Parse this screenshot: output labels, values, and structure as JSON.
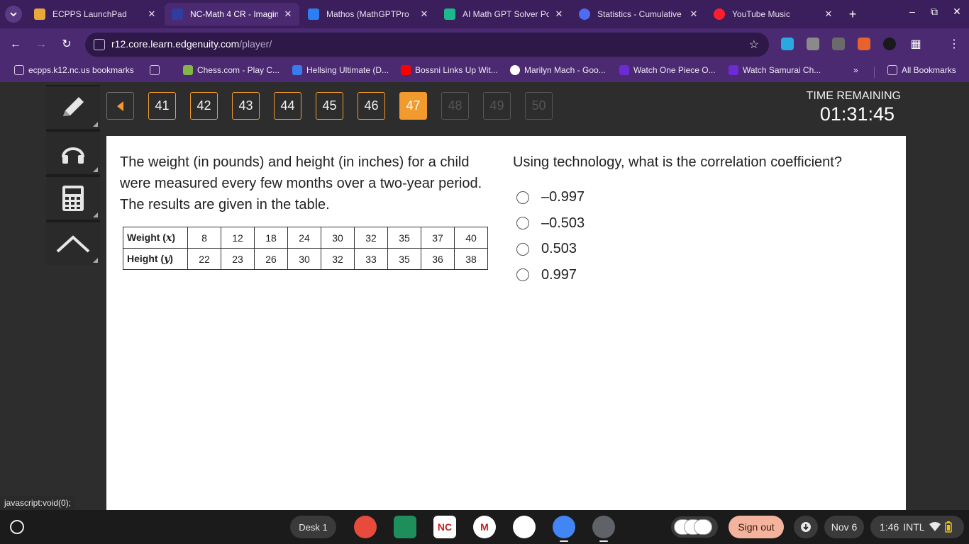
{
  "browser": {
    "tabs": [
      {
        "title": "ECPPS LaunchPad",
        "icon": "launchpad-icon",
        "color": "#e8a93a",
        "active": false
      },
      {
        "title": "NC-Math 4 CR - Imagin",
        "icon": "edgenuity-icon",
        "color": "#2f3da0",
        "active": true
      },
      {
        "title": "Mathos (MathGPTPro",
        "icon": "mathos-icon",
        "color": "#2d7ef0",
        "active": false
      },
      {
        "title": "AI Math GPT Solver Po",
        "icon": "mathgpt-icon",
        "color": "#1bb98c",
        "active": false
      },
      {
        "title": "Statistics - Cumulative",
        "icon": "search-icon",
        "color": "#4e6cf2",
        "active": false
      },
      {
        "title": "YouTube Music",
        "icon": "youtube-music-icon",
        "color": "#ff1e2d",
        "active": false
      }
    ],
    "url": {
      "host": "r12.core.learn.edgenuity.com",
      "path": "/player/"
    },
    "bookmarks": [
      {
        "label": "ecpps.k12.nc.us bookmarks",
        "icon": "folder-icon",
        "color": "#d7cde6"
      },
      {
        "label": "",
        "icon": "apps-grid-icon",
        "color": "#d7cde6"
      },
      {
        "label": "Chess.com - Play C...",
        "icon": "chess-icon",
        "color": "#84b547"
      },
      {
        "label": "Hellsing Ultimate (D...",
        "icon": "anime-icon",
        "color": "#3b7bf0"
      },
      {
        "label": "Bossni Links Up Wit...",
        "icon": "youtube-icon",
        "color": "#ff0000"
      },
      {
        "label": "Marilyn Mach - Goo...",
        "icon": "google-icon",
        "color": "#ffffff"
      },
      {
        "label": "Watch One Piece O...",
        "icon": "crunchyroll-icon",
        "color": "#6b2bd6"
      },
      {
        "label": "Watch Samurai Ch...",
        "icon": "crunchyroll-icon",
        "color": "#6b2bd6"
      }
    ],
    "all_bookmarks": "All Bookmarks"
  },
  "player": {
    "questions": [
      {
        "num": "41",
        "state": "answered"
      },
      {
        "num": "42",
        "state": "answered"
      },
      {
        "num": "43",
        "state": "answered"
      },
      {
        "num": "44",
        "state": "answered"
      },
      {
        "num": "45",
        "state": "answered"
      },
      {
        "num": "46",
        "state": "answered"
      },
      {
        "num": "47",
        "state": "current"
      },
      {
        "num": "48",
        "state": "locked"
      },
      {
        "num": "49",
        "state": "locked"
      },
      {
        "num": "50",
        "state": "locked"
      }
    ],
    "timer_label": "TIME REMAINING",
    "timer_value": "01:31:45",
    "accent": "#f29a2e",
    "stem": "The weight (in pounds) and height (in inches) for a child were measured every few months over a two-year period. The results are given in the table.",
    "table": {
      "row1_label": "Weight (",
      "row1_var": "x",
      "row2_label": "Height (",
      "row2_var": "y",
      "close": ")",
      "weight": [
        "8",
        "12",
        "18",
        "24",
        "30",
        "32",
        "35",
        "37",
        "40"
      ],
      "height": [
        "22",
        "23",
        "26",
        "30",
        "32",
        "33",
        "35",
        "36",
        "38"
      ]
    },
    "question": "Using technology, what is the correlation coefficient?",
    "choices": [
      "–0.997",
      "–0.503",
      "0.503",
      "0.997"
    ]
  },
  "status_url": "javascript:void(0);",
  "shelf": {
    "desk": "Desk 1",
    "apps": [
      {
        "name": "canvas-art-icon",
        "color": "#e84a3c",
        "label": ""
      },
      {
        "name": "classroom-icon",
        "color": "#1e8e5a",
        "label": ""
      },
      {
        "name": "nc-test-icon",
        "color": "#ffffff",
        "label": "NC"
      },
      {
        "name": "gmail-icon",
        "color": "#ffffff",
        "label": "M"
      },
      {
        "name": "play-store-icon",
        "color": "#ffffff",
        "label": ""
      },
      {
        "name": "chrome-icon",
        "color": "#4285f4",
        "label": ""
      },
      {
        "name": "settings-icon",
        "color": "#5f6368",
        "label": ""
      }
    ],
    "signout": "Sign out",
    "date": "Nov 6",
    "time": "1:46",
    "ime": "INTL"
  }
}
